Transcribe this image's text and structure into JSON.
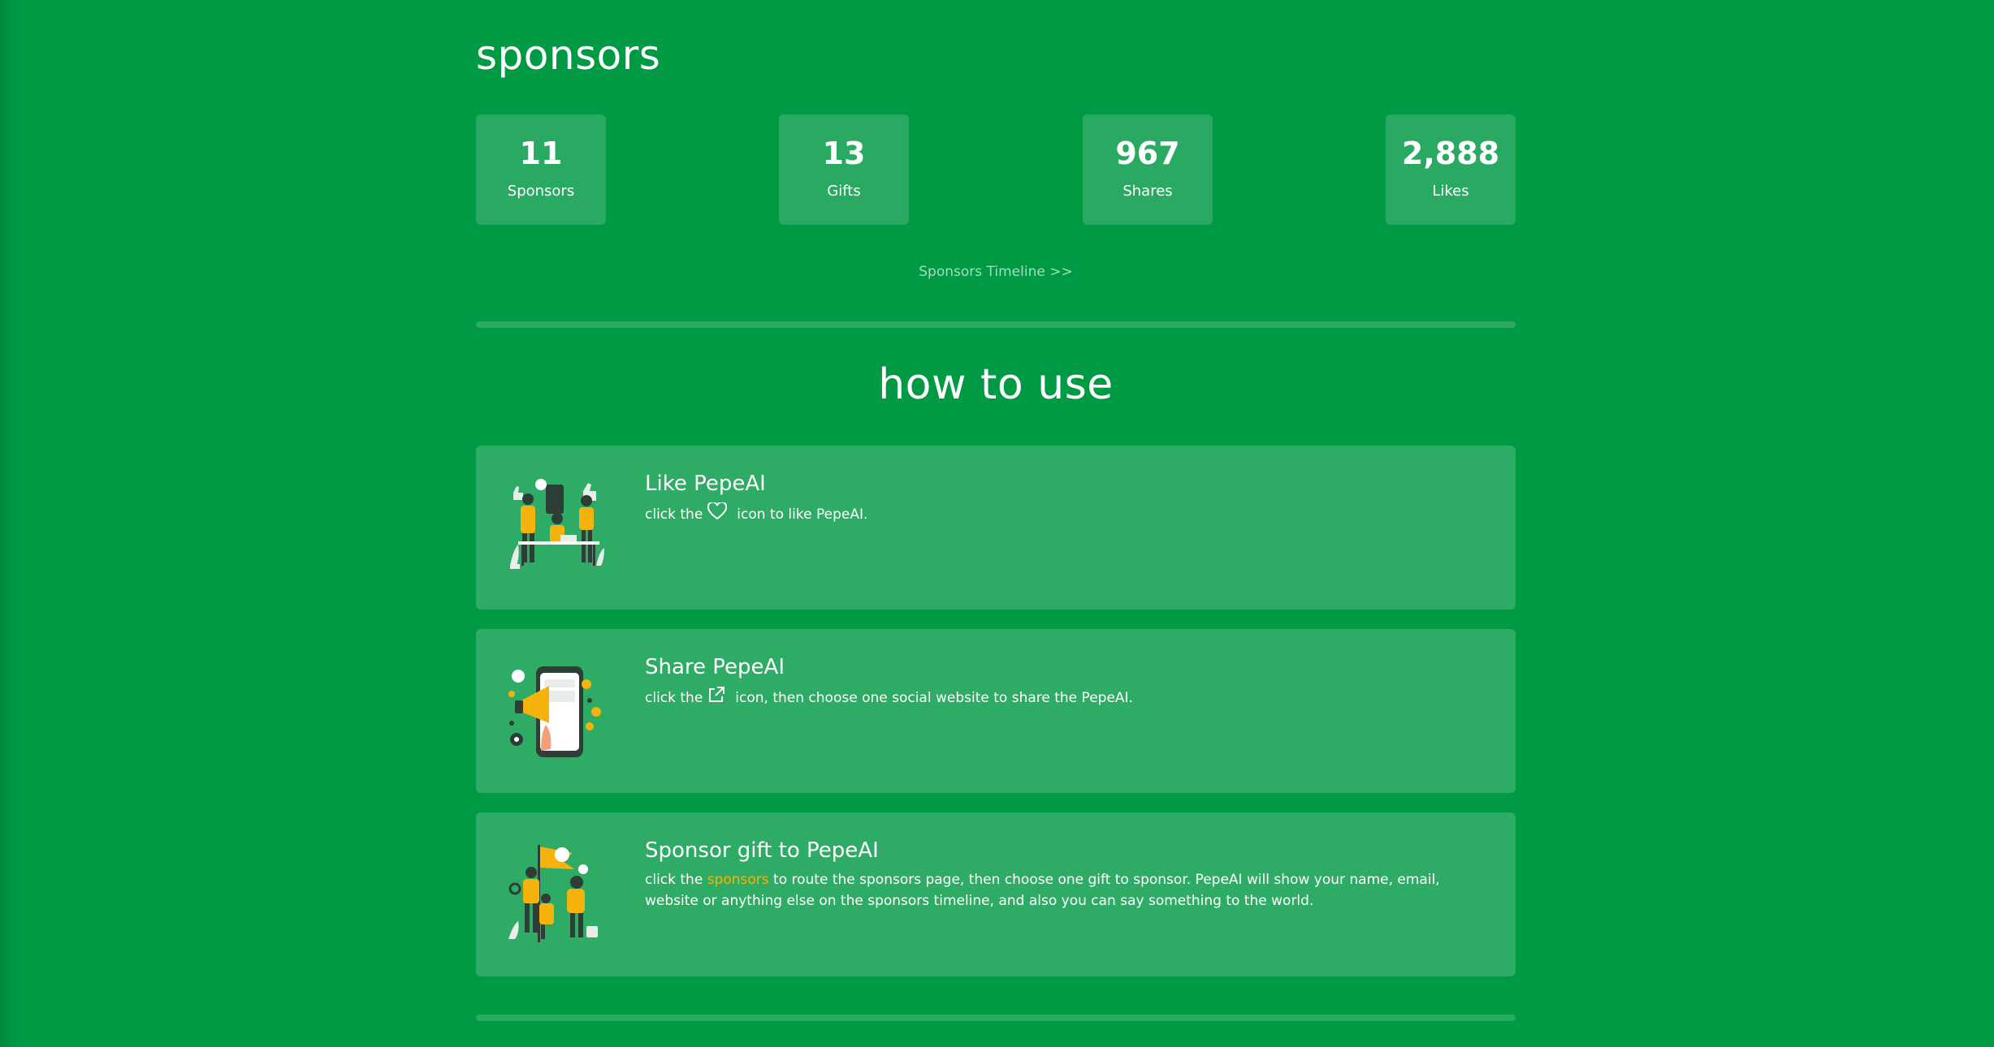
{
  "sponsors_section": {
    "title": "sponsors",
    "stats": [
      {
        "value": "11",
        "label": "Sponsors"
      },
      {
        "value": "13",
        "label": "Gifts"
      },
      {
        "value": "967",
        "label": "Shares"
      },
      {
        "value": "2,888",
        "label": "Likes"
      }
    ],
    "timeline_link": "Sponsors Timeline >>"
  },
  "how_to_use": {
    "title": "how to use",
    "cards": [
      {
        "title": "Like PepeAI",
        "text_before": "click the",
        "text_after": "icon to like PepeAI.",
        "icon": "heart-icon"
      },
      {
        "title": "Share PepeAI",
        "text_before": "click the",
        "text_after": "icon, then choose one social website to share the PepeAI.",
        "icon": "external-link-icon"
      },
      {
        "title": "Sponsor gift to PepeAI",
        "text_before": "click the",
        "link_text": "sponsors",
        "text_after": "to route the sponsors page, then choose one gift to sponsor. PepeAI will show your name, email, website or anything else on the sponsors timeline, and also you can say something to the world."
      }
    ]
  },
  "colors": {
    "background": "#009944",
    "card": "#33a86b",
    "accent": "#f7b30d"
  }
}
